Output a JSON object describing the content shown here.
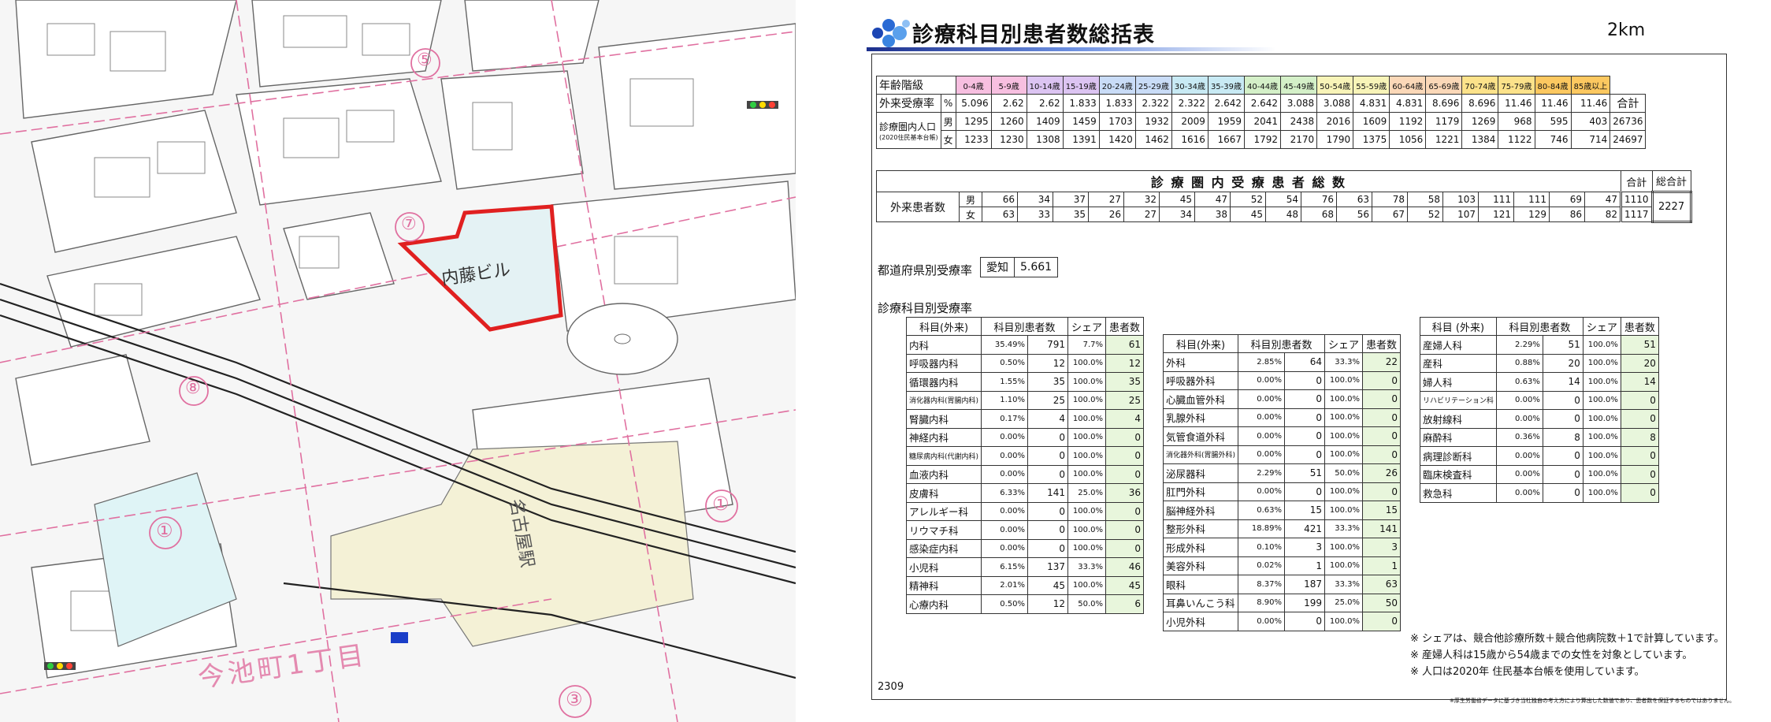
{
  "report": {
    "title": "診療科目別患者数総括表",
    "radius": "2km",
    "page_code": "2309",
    "footer_small": "※厚生労働省データに基づき当社独自の考え方により算出した数値であり、患者数を保証するものではありません。",
    "age_table": {
      "age_label": "年齢階級",
      "rate_label": "外来受療率",
      "rate_unit": "%",
      "pop_label": "診療圏内人口",
      "pop_sub": "(2020住民基本台帳)",
      "male": "男",
      "female": "女",
      "total": "合計",
      "ages": [
        "0-4歳",
        "5-9歳",
        "10-14歳",
        "15-19歳",
        "20-24歳",
        "25-29歳",
        "30-34歳",
        "35-39歳",
        "40-44歳",
        "45-49歳",
        "50-54歳",
        "55-59歳",
        "60-64歳",
        "65-69歳",
        "70-74歳",
        "75-79歳",
        "80-84歳",
        "85歳以上"
      ],
      "age_colors": [
        "#f7bfe0",
        "#f7bfe0",
        "#dcc4f2",
        "#dcc4f2",
        "#c9dcf7",
        "#c9dcf7",
        "#c8eaf4",
        "#c8eaf4",
        "#d4f0c8",
        "#d4f0c8",
        "#f8f4b8",
        "#f8f4b8",
        "#fbd8b8",
        "#fbd8b8",
        "#fce28a",
        "#fce28a",
        "#fcc860",
        "#fcc860"
      ],
      "rates": [
        "5.096",
        "2.62",
        "2.62",
        "1.833",
        "1.833",
        "2.322",
        "2.322",
        "2.642",
        "2.642",
        "3.088",
        "3.088",
        "4.831",
        "4.831",
        "8.696",
        "8.696",
        "11.46",
        "11.46",
        "11.46"
      ],
      "pop_male": [
        "1295",
        "1260",
        "1409",
        "1459",
        "1703",
        "1932",
        "2009",
        "1959",
        "2041",
        "2438",
        "2016",
        "1609",
        "1192",
        "1179",
        "1269",
        "968",
        "595",
        "403"
      ],
      "pop_male_total": "26736",
      "pop_female": [
        "1233",
        "1230",
        "1308",
        "1391",
        "1420",
        "1462",
        "1616",
        "1667",
        "1792",
        "2170",
        "1790",
        "1375",
        "1056",
        "1221",
        "1384",
        "1122",
        "746",
        "714"
      ],
      "pop_female_total": "24697"
    },
    "count_table": {
      "title": "診 療 圏 内 受 療 患 者 総 数",
      "row_label": "外来患者数",
      "male": "男",
      "female": "女",
      "total": "合計",
      "grand_total_label": "総合計",
      "male_counts": [
        "66",
        "34",
        "37",
        "27",
        "32",
        "45",
        "47",
        "52",
        "54",
        "76",
        "63",
        "78",
        "58",
        "103",
        "111",
        "111",
        "69",
        "47"
      ],
      "male_total": "1110",
      "female_counts": [
        "63",
        "33",
        "35",
        "26",
        "27",
        "34",
        "38",
        "45",
        "48",
        "68",
        "56",
        "67",
        "52",
        "107",
        "121",
        "129",
        "86",
        "82"
      ],
      "female_total": "1117",
      "grand_total": "2227"
    },
    "pref": {
      "label": "都道府県別受療率",
      "name": "愛知",
      "value": "5.661"
    },
    "dept": {
      "label": "診療科目別受療率",
      "headers1": [
        "科目(外来)",
        "科目別患者数",
        "シェア",
        "患者数"
      ],
      "headers2": [
        "科目(外来)",
        "科目別患者数",
        "シェア",
        "患者数"
      ],
      "headers3": [
        "科目 (外来)",
        "科目別患者数",
        "シェア",
        "患者数"
      ],
      "col1": [
        [
          "内科",
          "35.49%",
          "791",
          "7.7%",
          "61"
        ],
        [
          "呼吸器内科",
          "0.50%",
          "12",
          "100.0%",
          "12"
        ],
        [
          "循環器内科",
          "1.55%",
          "35",
          "100.0%",
          "35"
        ],
        [
          "消化器内科(胃腸内科)",
          "1.10%",
          "25",
          "100.0%",
          "25"
        ],
        [
          "腎臓内科",
          "0.17%",
          "4",
          "100.0%",
          "4"
        ],
        [
          "神経内科",
          "0.00%",
          "0",
          "100.0%",
          "0"
        ],
        [
          "糖尿病内科(代謝内科)",
          "0.00%",
          "0",
          "100.0%",
          "0"
        ],
        [
          "血液内科",
          "0.00%",
          "0",
          "100.0%",
          "0"
        ],
        [
          "皮膚科",
          "6.33%",
          "141",
          "25.0%",
          "36"
        ],
        [
          "アレルギー科",
          "0.00%",
          "0",
          "100.0%",
          "0"
        ],
        [
          "リウマチ科",
          "0.00%",
          "0",
          "100.0%",
          "0"
        ],
        [
          "感染症内科",
          "0.00%",
          "0",
          "100.0%",
          "0"
        ],
        [
          "小児科",
          "6.15%",
          "137",
          "33.3%",
          "46"
        ],
        [
          "精神科",
          "2.01%",
          "45",
          "100.0%",
          "45"
        ],
        [
          "心療内科",
          "0.50%",
          "12",
          "50.0%",
          "6"
        ]
      ],
      "col2": [
        [
          "外科",
          "2.85%",
          "64",
          "33.3%",
          "22"
        ],
        [
          "呼吸器外科",
          "0.00%",
          "0",
          "100.0%",
          "0"
        ],
        [
          "心臓血管外科",
          "0.00%",
          "0",
          "100.0%",
          "0"
        ],
        [
          "乳腺外科",
          "0.00%",
          "0",
          "100.0%",
          "0"
        ],
        [
          "気管食道外科",
          "0.00%",
          "0",
          "100.0%",
          "0"
        ],
        [
          "消化器外科(胃腸外科)",
          "0.00%",
          "0",
          "100.0%",
          "0"
        ],
        [
          "泌尿器科",
          "2.29%",
          "51",
          "50.0%",
          "26"
        ],
        [
          "肛門外科",
          "0.00%",
          "0",
          "100.0%",
          "0"
        ],
        [
          "脳神経外科",
          "0.63%",
          "15",
          "100.0%",
          "15"
        ],
        [
          "整形外科",
          "18.89%",
          "421",
          "33.3%",
          "141"
        ],
        [
          "形成外科",
          "0.10%",
          "3",
          "100.0%",
          "3"
        ],
        [
          "美容外科",
          "0.02%",
          "1",
          "100.0%",
          "1"
        ],
        [
          "眼科",
          "8.37%",
          "187",
          "33.3%",
          "63"
        ],
        [
          "耳鼻いんこう科",
          "8.90%",
          "199",
          "25.0%",
          "50"
        ],
        [
          "小児外科",
          "0.00%",
          "0",
          "100.0%",
          "0"
        ]
      ],
      "col3": [
        [
          "産婦人科",
          "2.29%",
          "51",
          "100.0%",
          "51"
        ],
        [
          "産科",
          "0.88%",
          "20",
          "100.0%",
          "20"
        ],
        [
          "婦人科",
          "0.63%",
          "14",
          "100.0%",
          "14"
        ],
        [
          "リハビリテーション科",
          "0.00%",
          "0",
          "100.0%",
          "0"
        ],
        [
          "放射線科",
          "0.00%",
          "0",
          "100.0%",
          "0"
        ],
        [
          "麻酔科",
          "0.36%",
          "8",
          "100.0%",
          "8"
        ],
        [
          "病理診断科",
          "0.00%",
          "0",
          "100.0%",
          "0"
        ],
        [
          "臨床検査科",
          "0.00%",
          "0",
          "100.0%",
          "0"
        ],
        [
          "救急科",
          "0.00%",
          "0",
          "100.0%",
          "0"
        ]
      ]
    },
    "notes": [
      "※ シェアは、競合他診療所数＋競合他病院数＋1で計算しています。",
      "※ 産婦人科は15歳から54歳までの女性を対象としています。",
      "※ 人口は2020年 住民基本台帳を使用しています。"
    ]
  },
  "map": {
    "building_label": "内藤ビル",
    "district_label": "今池町1丁目",
    "station_label": "名古屋駅",
    "block_numbers": [
      "⑤",
      "⑦",
      "⑧",
      "①",
      "①",
      "③"
    ],
    "highlight_color": "#e02020"
  }
}
